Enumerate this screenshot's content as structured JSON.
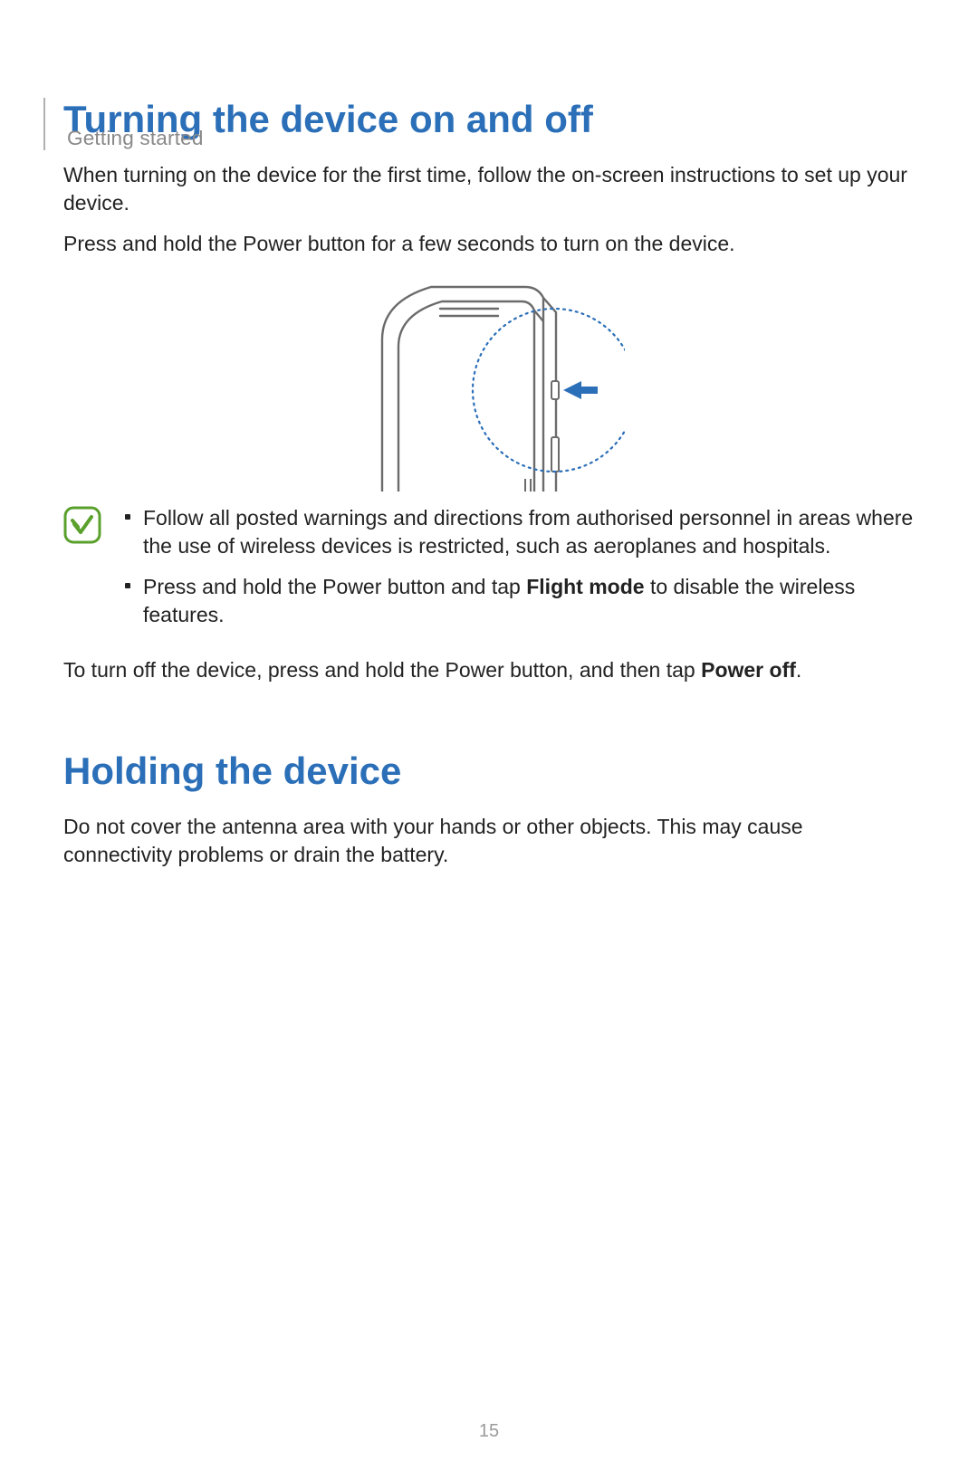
{
  "runningHead": "Getting started",
  "pageNumber": "15",
  "sections": {
    "turning": {
      "heading": "Turning the device on and off",
      "para1": "When turning on the device for the first time, follow the on-screen instructions to set up your device.",
      "para2": "Press and hold the Power button for a few seconds to turn on the device.",
      "bullet1": "Follow all posted warnings and directions from authorised personnel in areas where the use of wireless devices is restricted, such as aeroplanes and hospitals.",
      "bullet2_pre": "Press and hold the Power button and tap ",
      "bullet2_bold": "Flight mode",
      "bullet2_post": " to disable the wireless features.",
      "para3_pre": "To turn off the device, press and hold the Power button, and then tap ",
      "para3_bold": "Power off",
      "para3_post": "."
    },
    "holding": {
      "heading": "Holding the device",
      "para1": "Do not cover the antenna area with your hands or other objects. This may cause connectivity problems or drain the battery."
    }
  }
}
